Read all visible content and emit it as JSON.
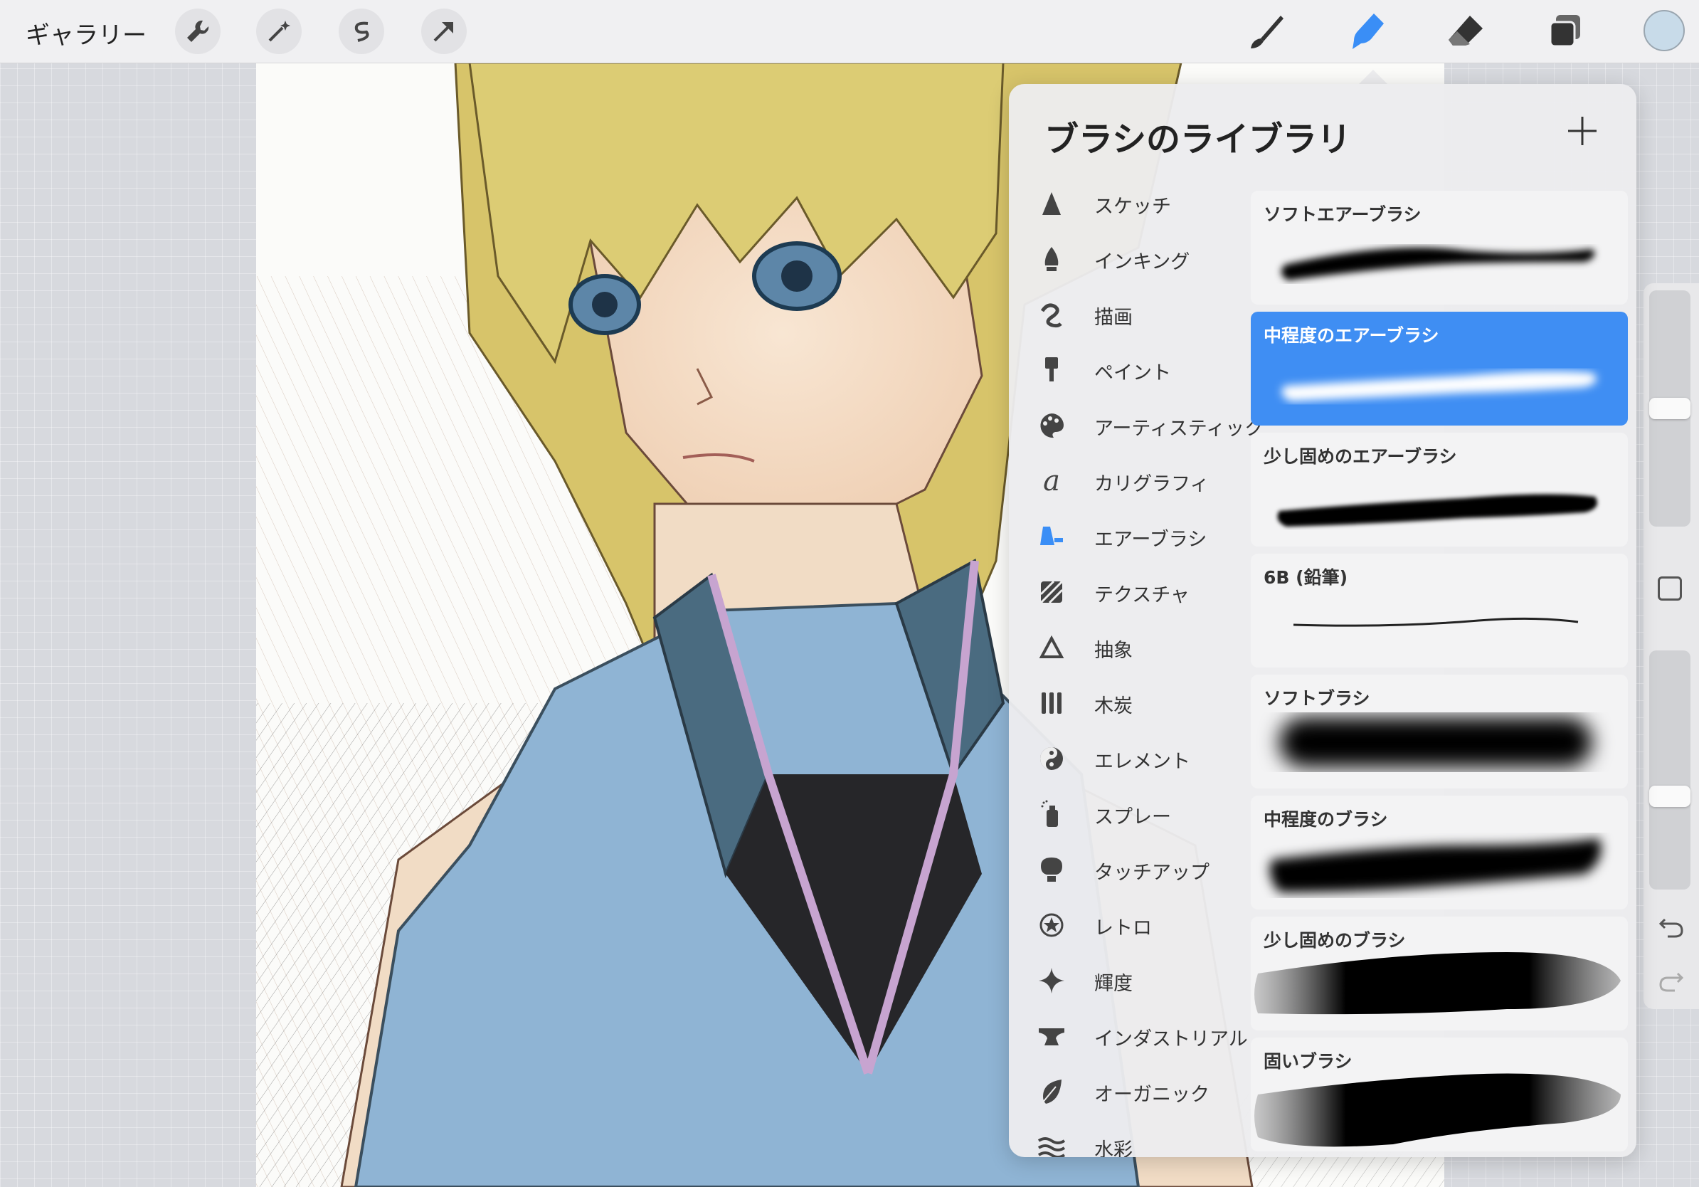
{
  "topbar": {
    "gallery_label": "ギャラリー",
    "left_tools": [
      "wrench-icon",
      "magic-wand-icon",
      "selection-icon",
      "transform-arrow-icon"
    ],
    "right_tools": [
      "paintbrush-icon",
      "smudge-icon",
      "eraser-icon",
      "layers-icon"
    ],
    "active_tool": "smudge-icon",
    "accent_color": "#3a8ef6",
    "current_color": "#c8dbe9"
  },
  "library": {
    "title": "ブラシのライブラリ",
    "add_label": "+",
    "categories": [
      {
        "label": "スケッチ",
        "icon": "sketch-icon"
      },
      {
        "label": "インキング",
        "icon": "ink-pen-icon"
      },
      {
        "label": "描画",
        "icon": "drawing-icon"
      },
      {
        "label": "ペイント",
        "icon": "paint-brush-icon"
      },
      {
        "label": "アーティスティック",
        "icon": "palette-icon"
      },
      {
        "label": "カリグラフィ",
        "icon": "calligraphy-icon"
      },
      {
        "label": "エアーブラシ",
        "icon": "airbrush-icon"
      },
      {
        "label": "テクスチャ",
        "icon": "texture-icon"
      },
      {
        "label": "抽象",
        "icon": "triangle-icon"
      },
      {
        "label": "木炭",
        "icon": "charcoal-icon"
      },
      {
        "label": "エレメント",
        "icon": "yin-yang-icon"
      },
      {
        "label": "スプレー",
        "icon": "spray-can-icon"
      },
      {
        "label": "タッチアップ",
        "icon": "touchup-icon"
      },
      {
        "label": "レトロ",
        "icon": "star-circle-icon"
      },
      {
        "label": "輝度",
        "icon": "sparkle-icon"
      },
      {
        "label": "インダストリアル",
        "icon": "anvil-icon"
      },
      {
        "label": "オーガニック",
        "icon": "leaf-icon"
      },
      {
        "label": "水彩",
        "icon": "waves-icon"
      }
    ],
    "active_category": "エアーブラシ",
    "brushes": [
      {
        "label": "ソフトエアーブラシ"
      },
      {
        "label": "中程度のエアーブラシ"
      },
      {
        "label": "少し固めのエアーブラシ"
      },
      {
        "label": "6B (鉛筆)"
      },
      {
        "label": "ソフトブラシ"
      },
      {
        "label": "中程度のブラシ"
      },
      {
        "label": "少し固めのブラシ"
      },
      {
        "label": "固いブラシ"
      }
    ],
    "selected_brush": "中程度のエアーブラシ"
  },
  "sidebar": {
    "size_level": 0.5,
    "opacity_level": 0.38,
    "modify_button": "square-icon",
    "undo": "undo-icon",
    "redo": "redo-icon"
  }
}
